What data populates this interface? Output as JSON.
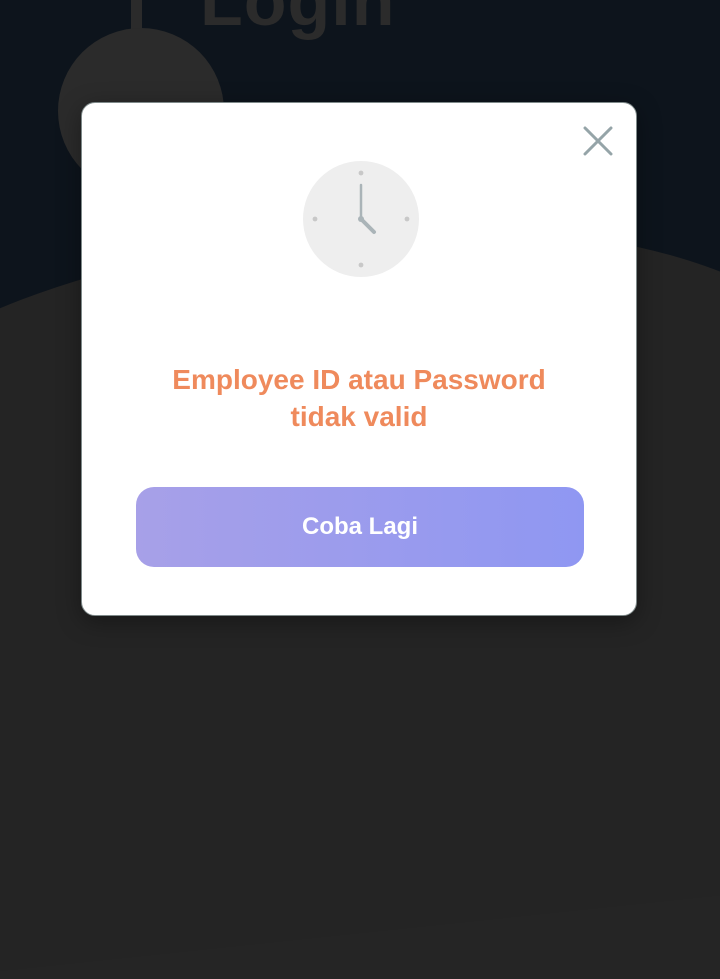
{
  "background": {
    "title": "Login"
  },
  "dialog": {
    "icon": "clock-icon",
    "message_line1": "Employee ID atau Password",
    "message_line2": "tidak valid",
    "retry_label": "Coba Lagi",
    "close_icon": "close-icon"
  },
  "colors": {
    "message": "#ef8a5c",
    "button_gradient_start": "#a7a0e8",
    "button_gradient_end": "#8f97f2",
    "overlay": "#252525"
  }
}
